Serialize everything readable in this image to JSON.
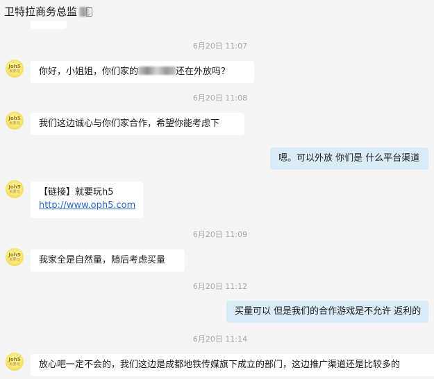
{
  "header": {
    "title": "卫特拉商务总监"
  },
  "messages": [
    {
      "time": "6月20日  11:07",
      "side": "in",
      "before": "你好，小姐姐，你们家的",
      "after": "还在外放吗？"
    },
    {
      "time": "6月20日  11:08",
      "side": "in",
      "text": "我们这边诚心与你们家合作，希望你能考虑下"
    },
    {
      "side": "out",
      "text": "嗯。可以外放 你们是 什么平台渠道"
    },
    {
      "side": "in",
      "line1": "【链接】就要玩h5",
      "link": "http://www.oph5.com"
    },
    {
      "time": "6月20日  11:09",
      "side": "in",
      "text": "我家全是自然量，随后考虑买量"
    },
    {
      "time": "6月20日  11:12",
      "side": "out",
      "text": "买量可以 但是我们的合作游戏是不允许 返利的"
    },
    {
      "time": "6月20日  11:14",
      "side": "in",
      "text": "放心吧一定不会的，我们这边是成都地铁传媒旗下成立的部门，这边推广渠道还是比较多的"
    }
  ],
  "avatar": {
    "icon": "avatar-yellow-logo",
    "text": "Joh5",
    "sub": "就要玩"
  },
  "colors": {
    "incoming": "#ffffff",
    "outgoing": "#d9ebf7",
    "background": "#f5f5f5",
    "link": "#2d6ac3"
  }
}
